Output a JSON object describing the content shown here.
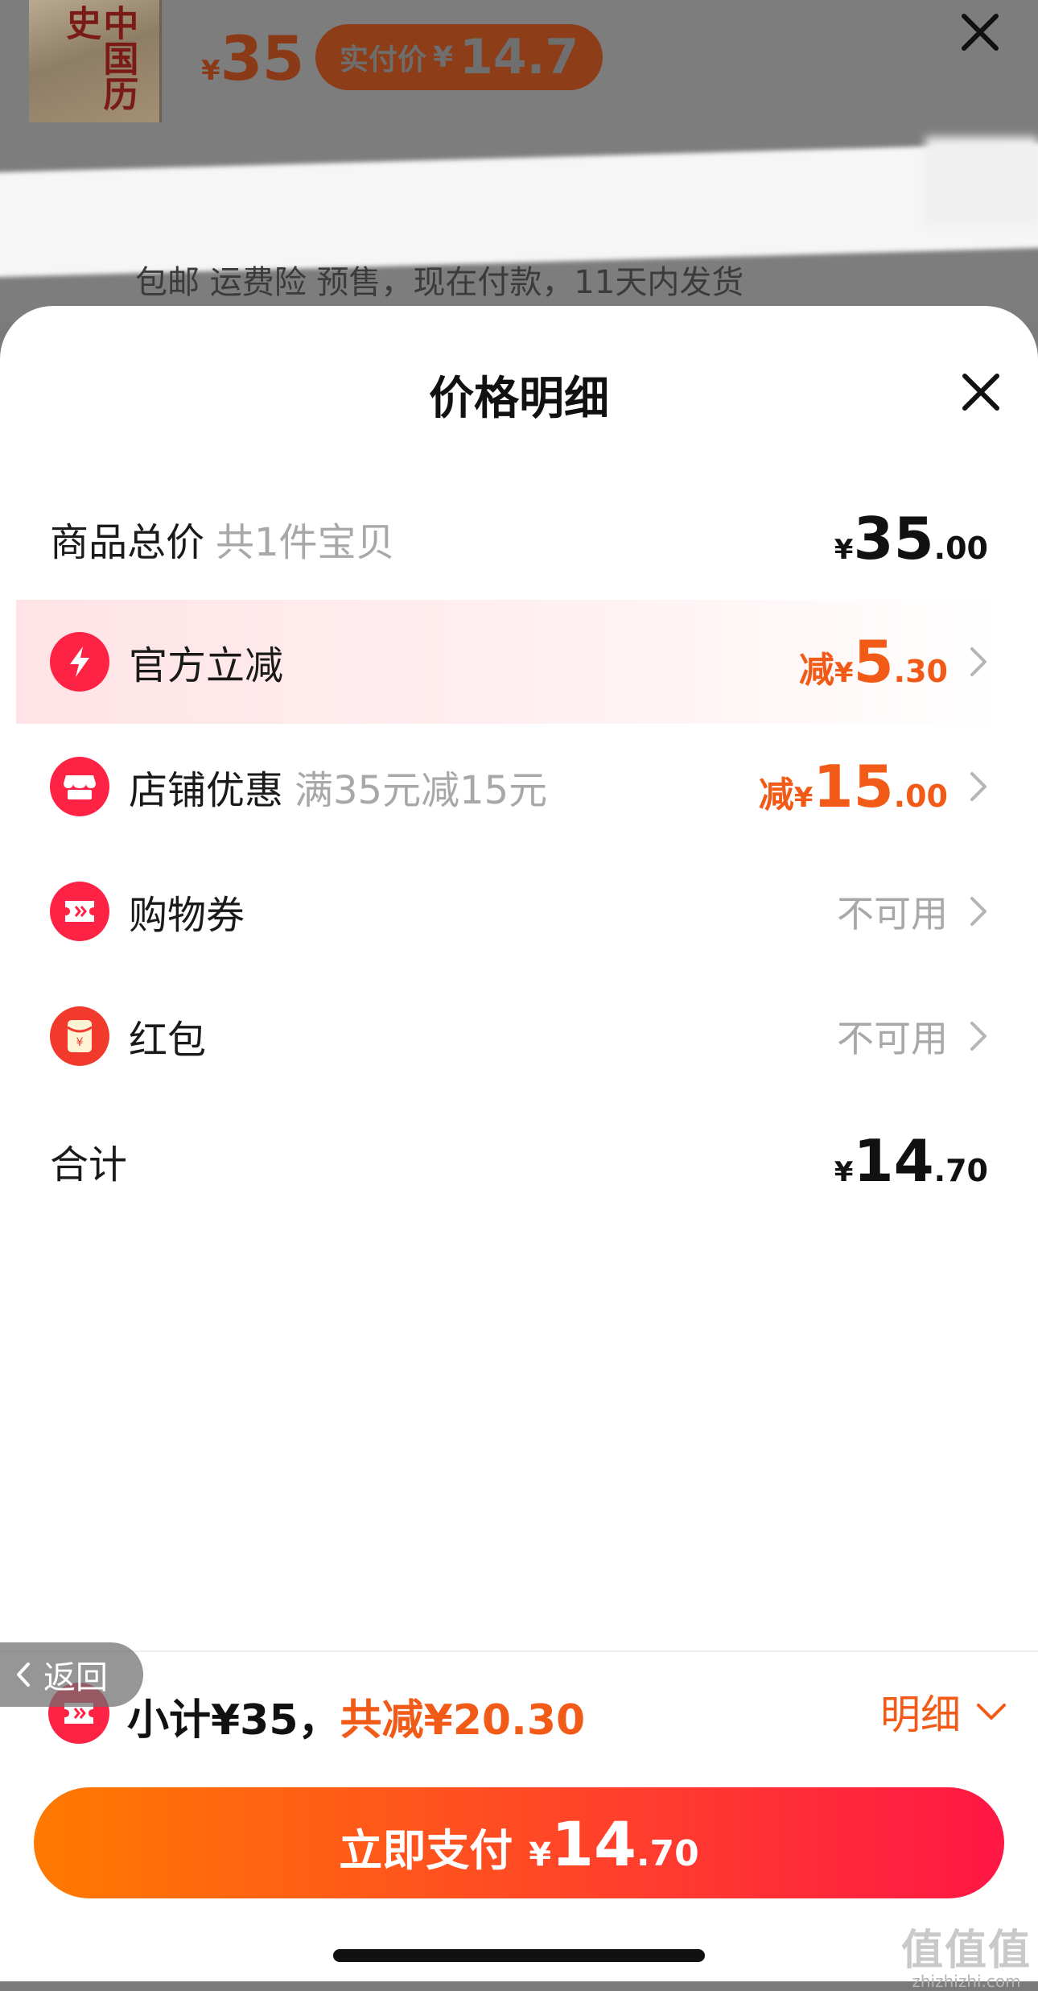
{
  "background": {
    "product_thumb_text": "中国历史",
    "price_currency": "¥",
    "price": "35",
    "actual_pay_label": "实付价",
    "actual_pay_currency": "¥",
    "actual_pay_value": "14.7",
    "service_line": "包邮 运费险 预售，现在付款，11天内发货"
  },
  "sheet": {
    "title": "价格明细",
    "total_row": {
      "label": "商品总价",
      "sub": "共1件宝贝",
      "currency": "¥",
      "int": "35",
      "dec": ".00"
    },
    "rows": [
      {
        "icon": "lightning-icon",
        "label": "官方立减",
        "sub": "",
        "prefix": "减",
        "currency": "¥",
        "int": "5",
        "dec": ".30"
      },
      {
        "icon": "store-icon",
        "label": "店铺优惠",
        "sub": "满35元减15元",
        "prefix": "减",
        "currency": "¥",
        "int": "15",
        "dec": ".00"
      },
      {
        "icon": "ticket-icon",
        "label": "购物券",
        "status": "不可用"
      },
      {
        "icon": "red-envelope-icon",
        "label": "红包",
        "status": "不可用"
      }
    ],
    "sum_row": {
      "label": "合计",
      "currency": "¥",
      "int": "14",
      "dec": ".70"
    }
  },
  "footer": {
    "back_label": "返回",
    "subtotal": "小计¥35，",
    "saved": "共减¥20.30",
    "detail_label": "明细",
    "pay_label": "立即支付",
    "pay_currency": "¥",
    "pay_int": "14",
    "pay_dec": ".70"
  },
  "watermark": {
    "big": "值值值",
    "small": "zhizhizhi.com"
  },
  "colors": {
    "accent_red": "#fe2244",
    "discount_orange": "#f25a17",
    "pay_gradient_start": "#ff7a00",
    "pay_gradient_end": "#ff1745"
  }
}
